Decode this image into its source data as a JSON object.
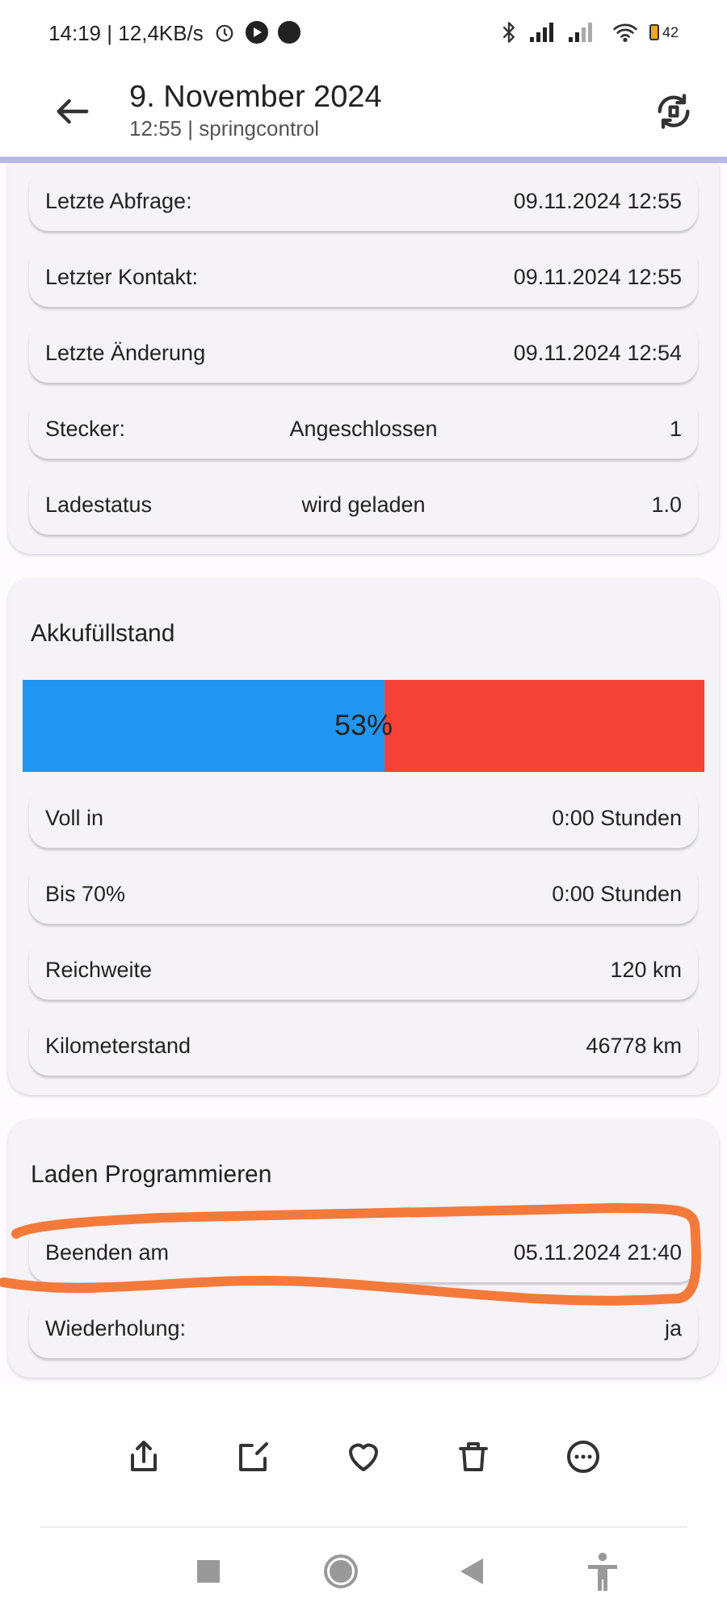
{
  "status_bar": {
    "text": "14:19 | 12,4KB/s",
    "battery": "42"
  },
  "header": {
    "title": "9. November 2024",
    "subtitle": "12:55 | springcontrol"
  },
  "cards": [
    {
      "rows": [
        {
          "label": "Letzte Abfrage:",
          "value": "09.11.2024 12:55"
        },
        {
          "label": "Letzter Kontakt:",
          "value": "09.11.2024 12:55"
        },
        {
          "label": "Letzte Änderung",
          "value": "09.11.2024 12:54"
        },
        {
          "label": "Stecker:",
          "middle": "Angeschlossen",
          "value": "1"
        },
        {
          "label": "Ladestatus",
          "middle": "wird geladen",
          "value": "1.0"
        }
      ]
    },
    {
      "title": "Akkufüllstand",
      "battery": {
        "level": 0.53,
        "label": "53%"
      },
      "rows": [
        {
          "label": "Voll in",
          "value": "0:00 Stunden"
        },
        {
          "label": "Bis 70%",
          "value": "0:00 Stunden"
        },
        {
          "label": "Reichweite",
          "value": "120 km"
        },
        {
          "label": "Kilometerstand",
          "value": "46778 km"
        }
      ]
    },
    {
      "title": "Laden Programmieren",
      "rows": [
        {
          "label": "Beenden am",
          "value": "05.11.2024 21:40"
        },
        {
          "label": "Wiederholung:",
          "value": "ja"
        }
      ]
    }
  ]
}
